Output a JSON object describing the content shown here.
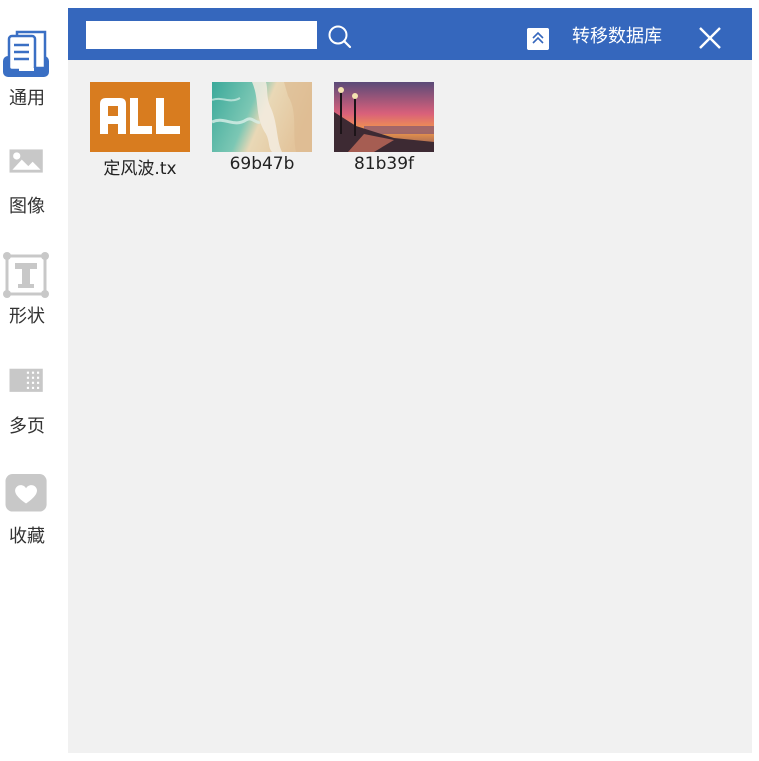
{
  "sidebar": {
    "items": [
      {
        "label": "通用",
        "icon": "document-icon"
      },
      {
        "label": "图像",
        "icon": "image-icon"
      },
      {
        "label": "形状",
        "icon": "text-shape-icon"
      },
      {
        "label": "多页",
        "icon": "multipage-icon"
      },
      {
        "label": "收藏",
        "icon": "heart-icon"
      }
    ]
  },
  "topbar": {
    "search_value": "",
    "search_placeholder": "",
    "transfer_label": "转移数据库",
    "color": "#3567bd"
  },
  "items": [
    {
      "label": "定风波.tx",
      "thumbnail": "all-text-thumbnail"
    },
    {
      "label": "69b47b",
      "thumbnail": "beach-aerial-thumbnail"
    },
    {
      "label": "81b39f",
      "thumbnail": "sunset-promenade-thumbnail"
    }
  ],
  "colors": {
    "accent": "#3567bd",
    "icon_active": "#3a6fc4",
    "icon_inactive": "#c8c8c8",
    "panel_bg": "#f1f1f1",
    "all_orange": "#d87c1f"
  }
}
